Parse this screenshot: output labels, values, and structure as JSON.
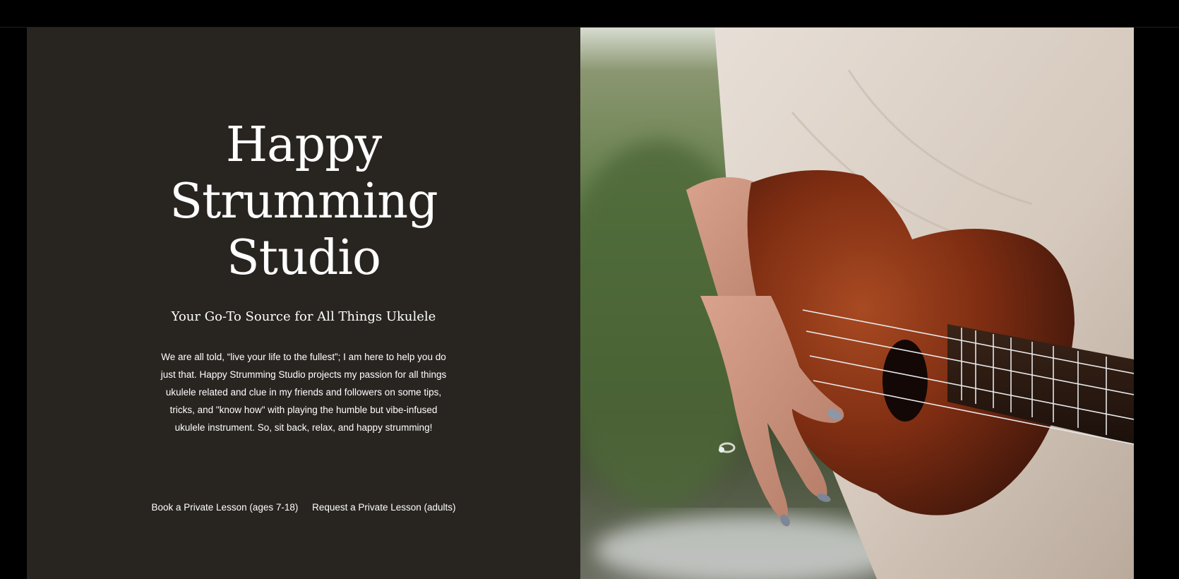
{
  "hero": {
    "title_line1": "Happy",
    "title_line2": "Strumming",
    "title_line3": "Studio",
    "subtitle": "Your Go-To Source for All Things Ukulele",
    "intro": "We are all told, “live your life to the fullest”; I am here to help you do just that. Happy Strumming Studio projects my passion for all things ukulele related and clue in my friends and followers on some tips, tricks, and \"know how\" with playing the humble but vibe-infused ukulele instrument. So, sit back, relax, and happy strumming!"
  },
  "links": {
    "kids_lesson": "Book a Private Lesson (ages 7-18)",
    "adult_lesson": "Request a Private Lesson (adults)"
  },
  "colors": {
    "panel_background": "#282521",
    "page_background": "#000000",
    "text": "#ffffff",
    "ukulele_wood": "#8a3414"
  }
}
